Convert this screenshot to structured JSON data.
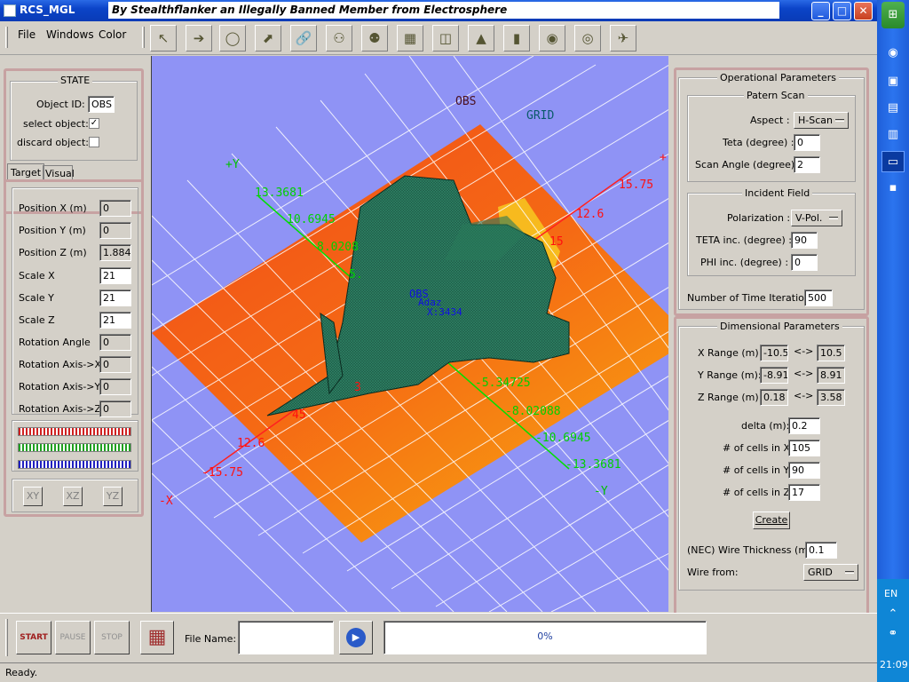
{
  "window": {
    "app_title": "RCS_MGL",
    "banner": "By Stealthflanker an Illegally Banned Member from Electrosphere"
  },
  "window_buttons": {
    "minimize": "_",
    "maximize": "□",
    "close": "✕"
  },
  "menu": [
    "File",
    "Windows",
    "Color"
  ],
  "toolbar_icons": [
    "pointer-icon",
    "arrow-right-icon",
    "ring-icon",
    "cursor-move-icon",
    "link-icon",
    "figures-icon",
    "figures-alt-icon",
    "grid-icon",
    "cube-icon",
    "cone-icon",
    "cylinder-icon",
    "sphere-icon",
    "torus-icon",
    "airplane-icon"
  ],
  "state": {
    "title": "STATE",
    "object_id_label": "Object ID:",
    "object_id": "OBS",
    "select_label": "select object:",
    "select_checked": "✓",
    "discard_label": "discard object:",
    "tabs": [
      "Target",
      "Visual"
    ],
    "fields": [
      {
        "label": "Position X (m)",
        "value": "0"
      },
      {
        "label": "Position Y (m)",
        "value": "0"
      },
      {
        "label": "Position Z (m)",
        "value": "1.884"
      },
      {
        "label": "Scale X",
        "value": "21"
      },
      {
        "label": "Scale Y",
        "value": "21"
      },
      {
        "label": "Scale Z",
        "value": "21"
      },
      {
        "label": "Rotation Angle",
        "value": "0"
      },
      {
        "label": "Rotation Axis->X",
        "value": "0"
      },
      {
        "label": "Rotation Axis->Y",
        "value": "0"
      },
      {
        "label": "Rotation Axis->Z",
        "value": "0"
      }
    ],
    "slider_colors": [
      "#d02020",
      "#20a020",
      "#2020c0"
    ],
    "plane_buttons": [
      "XY",
      "XZ",
      "YZ"
    ]
  },
  "viewport": {
    "obs_label": "OBS",
    "grid_label": "GRID",
    "axis_px": "+Y",
    "axis_nx": "-X",
    "axis_ny": "-Y",
    "axis_pz": "+",
    "red_ticks": [
      "15.75",
      "12.6",
      "12.6",
      "-15.75"
    ],
    "green_ticks": [
      "13.3681",
      "10.6945",
      "8.0208",
      "5.",
      "-5.34725",
      "-8.02088",
      "-10.6945",
      "-13.3681"
    ],
    "misc_labels": [
      "15",
      "3",
      "45"
    ],
    "center_labels": [
      "OBS",
      "Adaz",
      "X:3434"
    ]
  },
  "ops": {
    "title": "Operational Parameters",
    "pattern": {
      "title": "Patern Scan",
      "aspect_label": "Aspect :",
      "aspect": "H-Scan",
      "teta_label": "Teta (degree) :",
      "teta": "0",
      "scan_label": "Scan Angle (degree) :",
      "scan": "2"
    },
    "incident": {
      "title": "Incident Field",
      "pol_label": "Polarization :",
      "pol": "V-Pol.",
      "teta_inc_label": "TETA inc. (degree) :",
      "teta_inc": "90",
      "phi_inc_label": "PHI inc. (degree) :",
      "phi_inc": "0"
    },
    "iter_label": "Number of Time Iteration",
    "iter": "500"
  },
  "dims": {
    "title": "Dimensional Parameters",
    "arrow": "<->",
    "x_label": "X Range (m):",
    "x_min": "-10.5",
    "x_max": "10.5",
    "y_label": "Y Range (m):",
    "y_min": "-8.91",
    "y_max": "8.91",
    "z_label": "Z Range (m):",
    "z_min": "0.18",
    "z_max": "3.58",
    "delta_label": "delta (m):",
    "delta": "0.2",
    "nx_label": "# of cells in X:",
    "nx": "105",
    "ny_label": "# of cells in Y:",
    "ny": "90",
    "nz_label": "# of cells in Z:",
    "nz": "17",
    "create": "Create",
    "wire_label": "(NEC) Wire Thickness (m):",
    "wire": "0.1",
    "from_label": "Wire from:",
    "from": "GRID"
  },
  "bottom": {
    "start": "START",
    "pause": "PAUSE",
    "stop": "STOP",
    "file_label": "File Name:",
    "file_value": "",
    "progress": "0%",
    "progress_fraction": 0
  },
  "status": "Ready.",
  "taskbar": {
    "lang": "EN",
    "time": "21:09"
  }
}
